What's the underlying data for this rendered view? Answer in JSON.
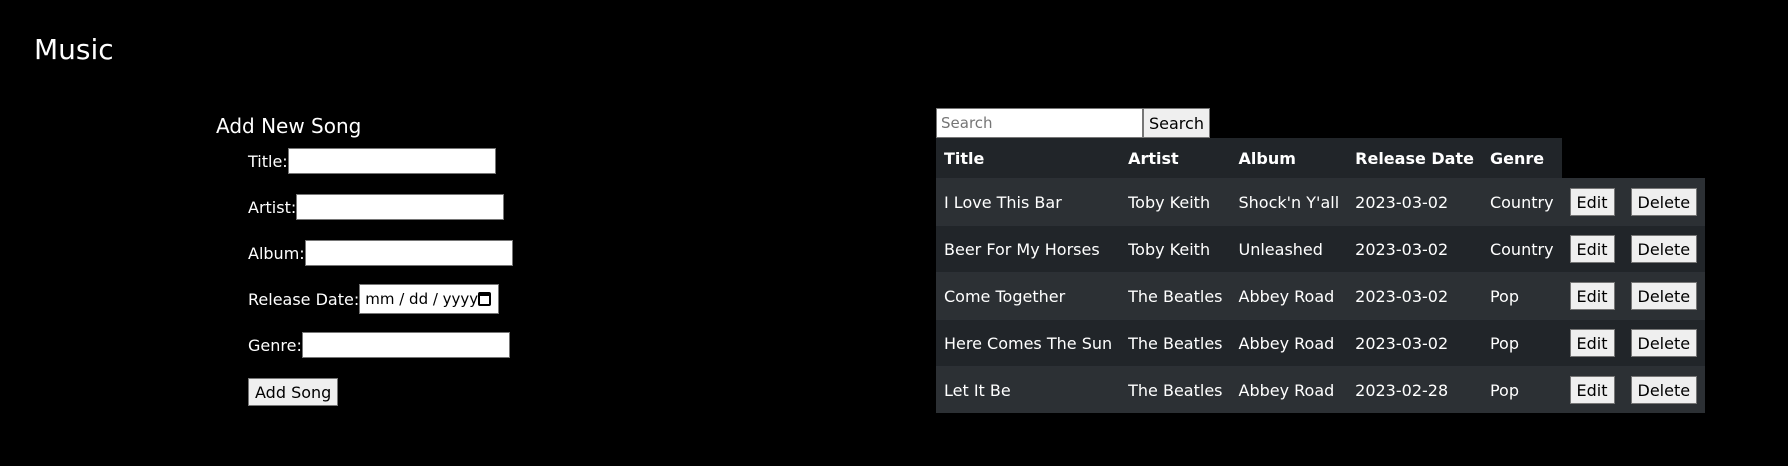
{
  "page": {
    "title": "Music"
  },
  "form": {
    "heading": "Add New Song",
    "fields": {
      "title_label": "Title:",
      "artist_label": "Artist:",
      "album_label": "Album:",
      "release_date_label": "Release Date:",
      "release_date_placeholder": "mm / dd / yyyy",
      "genre_label": "Genre:"
    },
    "values": {
      "title": "",
      "artist": "",
      "album": "",
      "genre": ""
    },
    "submit_label": "Add Song"
  },
  "search": {
    "placeholder": "Search",
    "value": "",
    "button_label": "Search"
  },
  "table": {
    "headers": [
      "Title",
      "Artist",
      "Album",
      "Release Date",
      "Genre"
    ],
    "edit_label": "Edit",
    "delete_label": "Delete",
    "rows": [
      {
        "title": "I Love This Bar",
        "artist": "Toby Keith",
        "album": "Shock'n Y'all",
        "release_date": "2023-03-02",
        "genre": "Country"
      },
      {
        "title": "Beer For My Horses",
        "artist": "Toby Keith",
        "album": "Unleashed",
        "release_date": "2023-03-02",
        "genre": "Country"
      },
      {
        "title": "Come Together",
        "artist": "The Beatles",
        "album": "Abbey Road",
        "release_date": "2023-03-02",
        "genre": "Pop"
      },
      {
        "title": "Here Comes The Sun",
        "artist": "The Beatles",
        "album": "Abbey Road",
        "release_date": "2023-03-02",
        "genre": "Pop"
      },
      {
        "title": "Let It Be",
        "artist": "The Beatles",
        "album": "Abbey Road",
        "release_date": "2023-02-28",
        "genre": "Pop"
      }
    ]
  },
  "colors": {
    "background": "#000000",
    "table_row": "#212529",
    "table_row_alt": "#2c3034",
    "text": "#ffffff"
  },
  "icons": {
    "date_picker": "calendar-icon"
  }
}
